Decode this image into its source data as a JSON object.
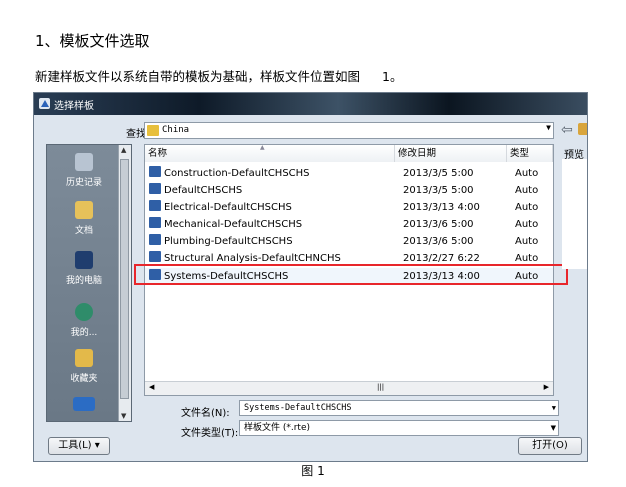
{
  "heading": "1、模板文件选取",
  "paragraph": {
    "text": "新建样板文件以系统自带的模板为基础，样板文件位置如图",
    "figure_ref": "1。"
  },
  "dialog": {
    "title": "选择样板",
    "look_in_label": "查找范围(I):",
    "look_in_value": "China",
    "places": [
      "历史记录",
      "文档",
      "我的电脑",
      "我的...",
      "收藏夹"
    ],
    "columns": {
      "name": "名称",
      "date": "修改日期",
      "type": "类型"
    },
    "files": [
      {
        "name": "Construction-DefaultCHSCHS",
        "date": "2013/3/5 5:00",
        "type": "Auto"
      },
      {
        "name": "DefaultCHSCHS",
        "date": "2013/3/5 5:00",
        "type": "Auto"
      },
      {
        "name": "Electrical-DefaultCHSCHS",
        "date": "2013/3/13 4:00",
        "type": "Auto"
      },
      {
        "name": "Mechanical-DefaultCHSCHS",
        "date": "2013/3/6 5:00",
        "type": "Auto"
      },
      {
        "name": "Plumbing-DefaultCHSCHS",
        "date": "2013/3/6 5:00",
        "type": "Auto"
      },
      {
        "name": "Structural Analysis-DefaultCHNCHS",
        "date": "2013/2/27 6:22",
        "type": "Auto"
      },
      {
        "name": "Systems-DefaultCHSCHS",
        "date": "2013/3/13 4:00",
        "type": "Auto"
      }
    ],
    "selected_index": 6,
    "preview_label": "预览",
    "preview_mark": "♪",
    "file_name_label": "文件名(N):",
    "file_name_value": "Systems-DefaultCHSCHS",
    "file_type_label": "文件类型(T):",
    "file_type_value": "样板文件 (*.rte)",
    "tools_button": "工具(L)",
    "open_button": "打开(O)"
  },
  "caption": "图 1",
  "colors": {
    "highlight_border": "#e8262b",
    "titlebar": "#1b2a3a",
    "places_bg": "#7d8b99"
  }
}
